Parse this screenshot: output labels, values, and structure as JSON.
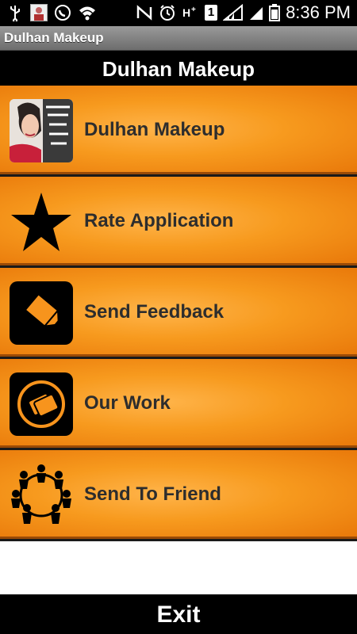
{
  "status_bar": {
    "time": "8:36 PM",
    "signal_badge": "1",
    "icons": [
      "usb-icon",
      "notification-photo-icon",
      "call-icon",
      "wifi-icon",
      "nfc-icon",
      "alarm-icon",
      "hplus-icon",
      "sim-icon",
      "signal-icon",
      "battery-icon"
    ]
  },
  "app_bar": {
    "title": "Dulhan Makeup"
  },
  "header": {
    "title": "Dulhan Makeup"
  },
  "menu": {
    "items": [
      {
        "label": "Dulhan Makeup",
        "icon": "bride-thumbnail-icon"
      },
      {
        "label": "Rate Application",
        "icon": "star-icon"
      },
      {
        "label": "Send Feedback",
        "icon": "pencil-icon"
      },
      {
        "label": "Our Work",
        "icon": "cards-icon"
      },
      {
        "label": "Send To Friend",
        "icon": "people-circle-icon"
      }
    ]
  },
  "exit": {
    "label": "Exit"
  },
  "colors": {
    "orange": "#f79a1e",
    "divider": "#9a4a06",
    "text": "#2d2d2d"
  }
}
